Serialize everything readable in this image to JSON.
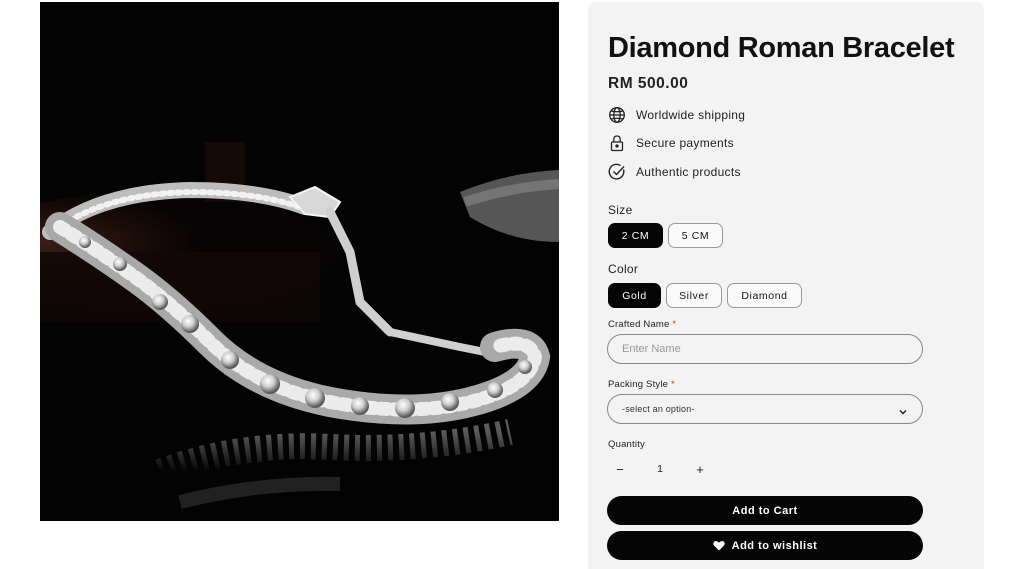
{
  "product": {
    "title": "Diamond Roman Bracelet",
    "price": "RM 500.00",
    "image_alt": "diamond-bracelet-photo"
  },
  "features": [
    {
      "icon": "globe-icon",
      "label": "Worldwide shipping"
    },
    {
      "icon": "lock-icon",
      "label": "Secure payments"
    },
    {
      "icon": "check-circle-icon",
      "label": "Authentic products"
    }
  ],
  "size": {
    "label": "Size",
    "options": [
      "2 CM",
      "5 CM"
    ],
    "selected": "2 CM"
  },
  "color": {
    "label": "Color",
    "options": [
      "Gold",
      "Silver",
      "Diamond"
    ],
    "selected": "Gold"
  },
  "crafted_name": {
    "label": "Crafted Name",
    "required_mark": "*",
    "placeholder": "Enter Name",
    "value": ""
  },
  "packing_style": {
    "label": "Packing Style",
    "required_mark": "*",
    "selected": "-select an option-"
  },
  "quantity": {
    "label": "Quantity",
    "minus": "−",
    "value": "1",
    "plus": "+"
  },
  "actions": {
    "add_to_cart": "Add to Cart",
    "add_to_wishlist": "Add to wishlist"
  },
  "colors": {
    "primary": "#050505",
    "panel_bg": "#f3f3f3",
    "required": "#e0332b"
  }
}
